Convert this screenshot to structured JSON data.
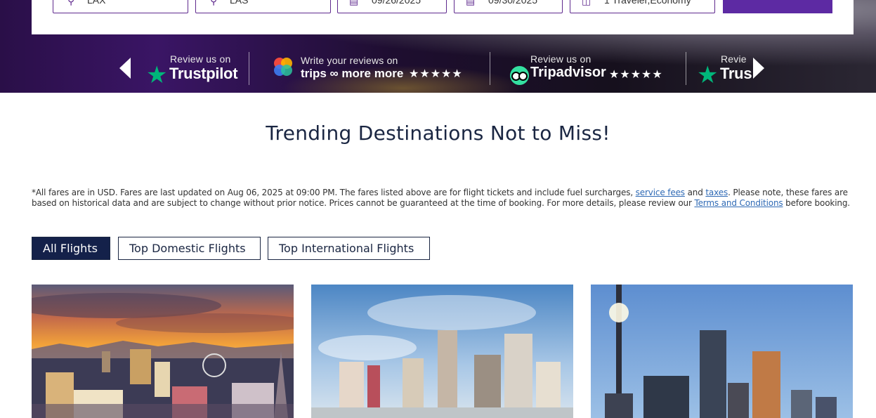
{
  "search": {
    "origin": "LAX",
    "destination": "LAS",
    "depart_date": "09/26/2025",
    "return_date": "09/30/2025",
    "travelers": "1 Traveler,Economy"
  },
  "reviews": {
    "trustpilot": {
      "prefix": "Review us on",
      "brand": "Trustpilot"
    },
    "trips": {
      "prefix": "Write your reviews on",
      "brand": "trips ∞ more more",
      "stars": "★★★★★"
    },
    "tripadvisor": {
      "prefix": "Review us on",
      "brand": "Tripadvisor",
      "stars": "★★★★★"
    },
    "trustpilot_repeat": {
      "prefix": "Revie",
      "brand": "Trus"
    }
  },
  "main": {
    "heading": "Trending Destinations Not to Miss!",
    "disclaimer": {
      "part1": "*All fares are in USD. Fares are last updated on Aug 06, 2025 at 09:00 PM. The fares listed above are for flight tickets and include fuel surcharges, ",
      "service_fees": "service fees",
      "and": " and ",
      "taxes": "taxes",
      "part2": ". Please note, these fares are based on historical data and are subject to change without prior notice. Prices cannot be guaranteed at the time of booking. For more details, please review our ",
      "terms": "Terms and Conditions",
      "part3": " before booking."
    },
    "tabs": [
      {
        "label": "All Flights",
        "active": true
      },
      {
        "label": "Top Domestic Flights",
        "active": false
      },
      {
        "label": "Top International Flights",
        "active": false
      }
    ]
  },
  "colors": {
    "brand_purple": "#5d2aa3",
    "navy": "#14214a",
    "link": "#2f6ab5",
    "trustpilot_green": "#00b67a",
    "tripadvisor_green": "#34e0a1"
  }
}
